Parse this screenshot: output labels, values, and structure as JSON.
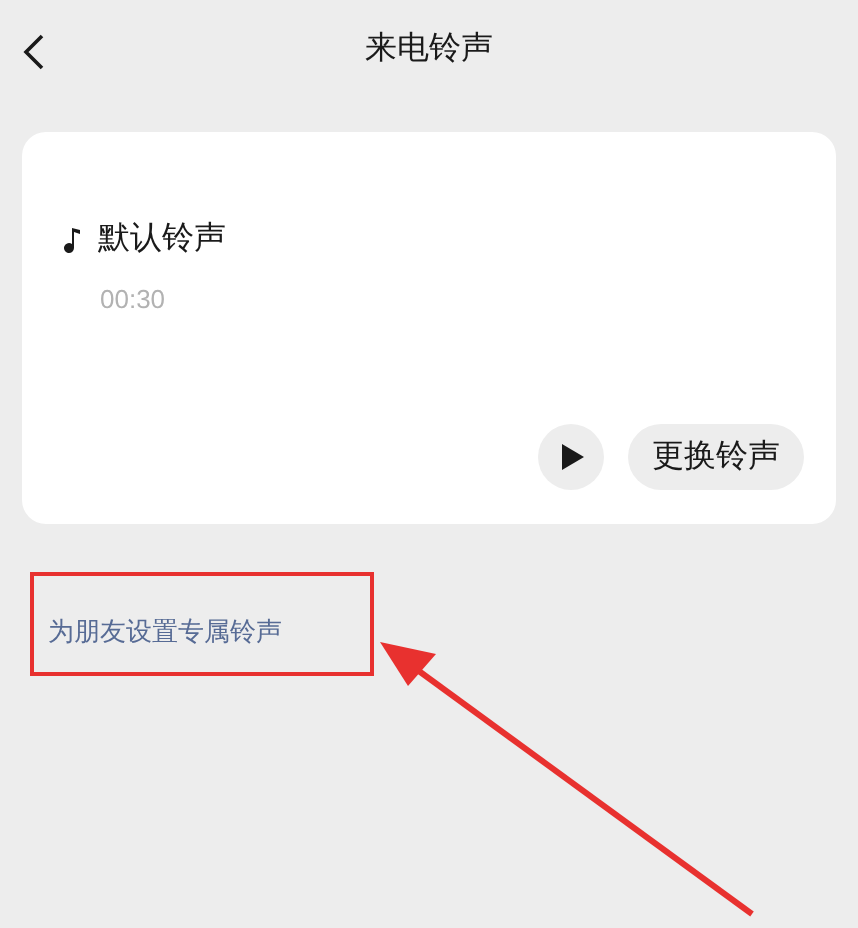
{
  "header": {
    "title": "来电铃声"
  },
  "ringtone": {
    "name": "默认铃声",
    "duration": "00:30",
    "change_button": "更换铃声"
  },
  "link": {
    "label": "为朋友设置专属铃声"
  },
  "annotation": {
    "kind": "highlight-arrow"
  }
}
